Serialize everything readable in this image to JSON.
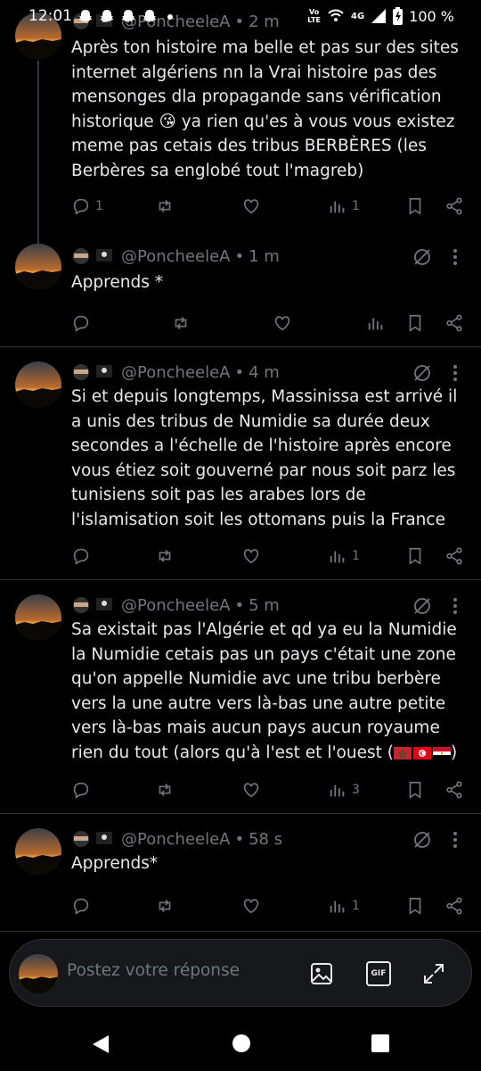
{
  "status_bar": {
    "time": "12:01",
    "volte": "Vo\nLTE",
    "network": "4G",
    "battery": "100 %"
  },
  "tweets": [
    {
      "handle": "@PoncheeleA",
      "time": "2 m",
      "text": "Après ton histoire ma belle et pas sur des sites internet algériens nn la Vrai histoire pas des mensonges dla propagande sans vérification historique 😘 ya rien qu'es à vous vous existez meme pas cetais des tribus BERBÈRES (les Berbères sa englobé tout l'magreb)",
      "replies": "1",
      "retweets": "",
      "likes": "",
      "views": "1"
    },
    {
      "handle": "@PoncheeleA",
      "time": "1 m",
      "text": "Apprends *",
      "replies": "",
      "retweets": "",
      "likes": "",
      "views": ""
    },
    {
      "handle": "@PoncheeleA",
      "time": "4 m",
      "text": "Si et depuis longtemps, Massinissa est arrivé il a unis des tribus de Numidie sa durée deux secondes a l'échelle de l'histoire après encore vous étiez soit gouverné par nous soit parz les tunisiens soit pas les arabes lors de l'islamisation soit les ottomans puis la France",
      "replies": "",
      "retweets": "",
      "likes": "",
      "views": "1"
    },
    {
      "handle": "@PoncheeleA",
      "time": "5 m",
      "text": "Sa existait pas l'Algérie et qd ya eu la Numidie la Numidie cetais pas un pays c'était une zone qu'on appelle Numidie avc une tribu berbère vers la une autre vers là-bas une autre petite vers là-bas mais aucun pays aucun royaume rien du tout (alors qu'à l'est et l'ouest (",
      "text_end": ")",
      "replies": "",
      "retweets": "",
      "likes": "",
      "views": "3"
    },
    {
      "handle": "@PoncheeleA",
      "time": "58 s",
      "text": "Apprends*",
      "replies": "",
      "retweets": "",
      "likes": "",
      "views": "1"
    }
  ],
  "name_sep": "•",
  "reply": {
    "placeholder": "Postez votre réponse",
    "gif_label": "GIF"
  },
  "colors": {
    "background": "#000000",
    "text": "#e7e9ea",
    "muted": "#71767b",
    "divider": "#2f3336"
  },
  "icons": [
    "reply-icon",
    "retweet-icon",
    "like-icon",
    "views-icon",
    "bookmark-icon",
    "share-icon",
    "grok-icon",
    "more-icon",
    "image-icon",
    "gif-icon",
    "expand-icon",
    "back-icon",
    "home-icon",
    "recents-icon"
  ]
}
